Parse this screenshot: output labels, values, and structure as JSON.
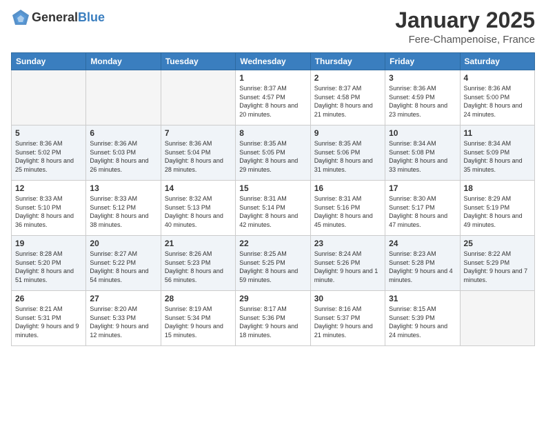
{
  "header": {
    "logo_text_general": "General",
    "logo_text_blue": "Blue",
    "month": "January 2025",
    "location": "Fere-Champenoise, France"
  },
  "weekdays": [
    "Sunday",
    "Monday",
    "Tuesday",
    "Wednesday",
    "Thursday",
    "Friday",
    "Saturday"
  ],
  "weeks": [
    [
      {
        "day": "",
        "sunrise": "",
        "sunset": "",
        "daylight": ""
      },
      {
        "day": "",
        "sunrise": "",
        "sunset": "",
        "daylight": ""
      },
      {
        "day": "",
        "sunrise": "",
        "sunset": "",
        "daylight": ""
      },
      {
        "day": "1",
        "sunrise": "Sunrise: 8:37 AM",
        "sunset": "Sunset: 4:57 PM",
        "daylight": "Daylight: 8 hours and 20 minutes."
      },
      {
        "day": "2",
        "sunrise": "Sunrise: 8:37 AM",
        "sunset": "Sunset: 4:58 PM",
        "daylight": "Daylight: 8 hours and 21 minutes."
      },
      {
        "day": "3",
        "sunrise": "Sunrise: 8:36 AM",
        "sunset": "Sunset: 4:59 PM",
        "daylight": "Daylight: 8 hours and 23 minutes."
      },
      {
        "day": "4",
        "sunrise": "Sunrise: 8:36 AM",
        "sunset": "Sunset: 5:00 PM",
        "daylight": "Daylight: 8 hours and 24 minutes."
      }
    ],
    [
      {
        "day": "5",
        "sunrise": "Sunrise: 8:36 AM",
        "sunset": "Sunset: 5:02 PM",
        "daylight": "Daylight: 8 hours and 25 minutes."
      },
      {
        "day": "6",
        "sunrise": "Sunrise: 8:36 AM",
        "sunset": "Sunset: 5:03 PM",
        "daylight": "Daylight: 8 hours and 26 minutes."
      },
      {
        "day": "7",
        "sunrise": "Sunrise: 8:36 AM",
        "sunset": "Sunset: 5:04 PM",
        "daylight": "Daylight: 8 hours and 28 minutes."
      },
      {
        "day": "8",
        "sunrise": "Sunrise: 8:35 AM",
        "sunset": "Sunset: 5:05 PM",
        "daylight": "Daylight: 8 hours and 29 minutes."
      },
      {
        "day": "9",
        "sunrise": "Sunrise: 8:35 AM",
        "sunset": "Sunset: 5:06 PM",
        "daylight": "Daylight: 8 hours and 31 minutes."
      },
      {
        "day": "10",
        "sunrise": "Sunrise: 8:34 AM",
        "sunset": "Sunset: 5:08 PM",
        "daylight": "Daylight: 8 hours and 33 minutes."
      },
      {
        "day": "11",
        "sunrise": "Sunrise: 8:34 AM",
        "sunset": "Sunset: 5:09 PM",
        "daylight": "Daylight: 8 hours and 35 minutes."
      }
    ],
    [
      {
        "day": "12",
        "sunrise": "Sunrise: 8:33 AM",
        "sunset": "Sunset: 5:10 PM",
        "daylight": "Daylight: 8 hours and 36 minutes."
      },
      {
        "day": "13",
        "sunrise": "Sunrise: 8:33 AM",
        "sunset": "Sunset: 5:12 PM",
        "daylight": "Daylight: 8 hours and 38 minutes."
      },
      {
        "day": "14",
        "sunrise": "Sunrise: 8:32 AM",
        "sunset": "Sunset: 5:13 PM",
        "daylight": "Daylight: 8 hours and 40 minutes."
      },
      {
        "day": "15",
        "sunrise": "Sunrise: 8:31 AM",
        "sunset": "Sunset: 5:14 PM",
        "daylight": "Daylight: 8 hours and 42 minutes."
      },
      {
        "day": "16",
        "sunrise": "Sunrise: 8:31 AM",
        "sunset": "Sunset: 5:16 PM",
        "daylight": "Daylight: 8 hours and 45 minutes."
      },
      {
        "day": "17",
        "sunrise": "Sunrise: 8:30 AM",
        "sunset": "Sunset: 5:17 PM",
        "daylight": "Daylight: 8 hours and 47 minutes."
      },
      {
        "day": "18",
        "sunrise": "Sunrise: 8:29 AM",
        "sunset": "Sunset: 5:19 PM",
        "daylight": "Daylight: 8 hours and 49 minutes."
      }
    ],
    [
      {
        "day": "19",
        "sunrise": "Sunrise: 8:28 AM",
        "sunset": "Sunset: 5:20 PM",
        "daylight": "Daylight: 8 hours and 51 minutes."
      },
      {
        "day": "20",
        "sunrise": "Sunrise: 8:27 AM",
        "sunset": "Sunset: 5:22 PM",
        "daylight": "Daylight: 8 hours and 54 minutes."
      },
      {
        "day": "21",
        "sunrise": "Sunrise: 8:26 AM",
        "sunset": "Sunset: 5:23 PM",
        "daylight": "Daylight: 8 hours and 56 minutes."
      },
      {
        "day": "22",
        "sunrise": "Sunrise: 8:25 AM",
        "sunset": "Sunset: 5:25 PM",
        "daylight": "Daylight: 8 hours and 59 minutes."
      },
      {
        "day": "23",
        "sunrise": "Sunrise: 8:24 AM",
        "sunset": "Sunset: 5:26 PM",
        "daylight": "Daylight: 9 hours and 1 minute."
      },
      {
        "day": "24",
        "sunrise": "Sunrise: 8:23 AM",
        "sunset": "Sunset: 5:28 PM",
        "daylight": "Daylight: 9 hours and 4 minutes."
      },
      {
        "day": "25",
        "sunrise": "Sunrise: 8:22 AM",
        "sunset": "Sunset: 5:29 PM",
        "daylight": "Daylight: 9 hours and 7 minutes."
      }
    ],
    [
      {
        "day": "26",
        "sunrise": "Sunrise: 8:21 AM",
        "sunset": "Sunset: 5:31 PM",
        "daylight": "Daylight: 9 hours and 9 minutes."
      },
      {
        "day": "27",
        "sunrise": "Sunrise: 8:20 AM",
        "sunset": "Sunset: 5:33 PM",
        "daylight": "Daylight: 9 hours and 12 minutes."
      },
      {
        "day": "28",
        "sunrise": "Sunrise: 8:19 AM",
        "sunset": "Sunset: 5:34 PM",
        "daylight": "Daylight: 9 hours and 15 minutes."
      },
      {
        "day": "29",
        "sunrise": "Sunrise: 8:17 AM",
        "sunset": "Sunset: 5:36 PM",
        "daylight": "Daylight: 9 hours and 18 minutes."
      },
      {
        "day": "30",
        "sunrise": "Sunrise: 8:16 AM",
        "sunset": "Sunset: 5:37 PM",
        "daylight": "Daylight: 9 hours and 21 minutes."
      },
      {
        "day": "31",
        "sunrise": "Sunrise: 8:15 AM",
        "sunset": "Sunset: 5:39 PM",
        "daylight": "Daylight: 9 hours and 24 minutes."
      },
      {
        "day": "",
        "sunrise": "",
        "sunset": "",
        "daylight": ""
      }
    ]
  ]
}
